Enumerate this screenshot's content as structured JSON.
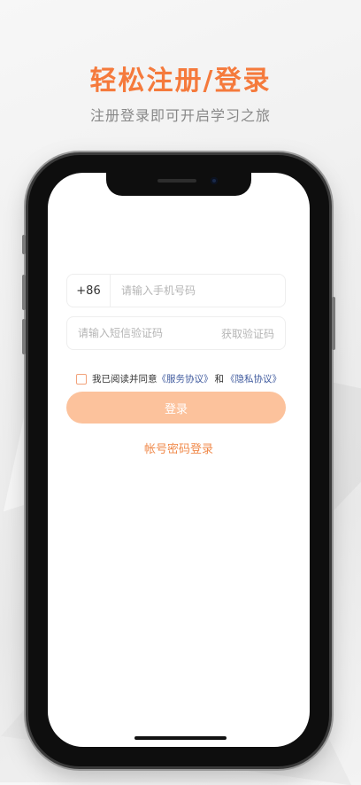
{
  "header": {
    "title": "轻松注册/登录",
    "subtitle": "注册登录即可开启学习之旅"
  },
  "form": {
    "country_code": "+86",
    "phone_placeholder": "请输入手机号码",
    "code_placeholder": "请输入短信验证码",
    "get_code_label": "获取验证码",
    "agree_prefix": "我已阅读并同意",
    "service_agreement": "《服务协议》",
    "and_text": "和",
    "privacy_agreement": "《隐私协议》",
    "login_label": "登录",
    "password_login_label": "帐号密码登录"
  },
  "colors": {
    "accent": "#f57a3c",
    "button": "#fcc29c",
    "link": "#3f5a9e"
  }
}
